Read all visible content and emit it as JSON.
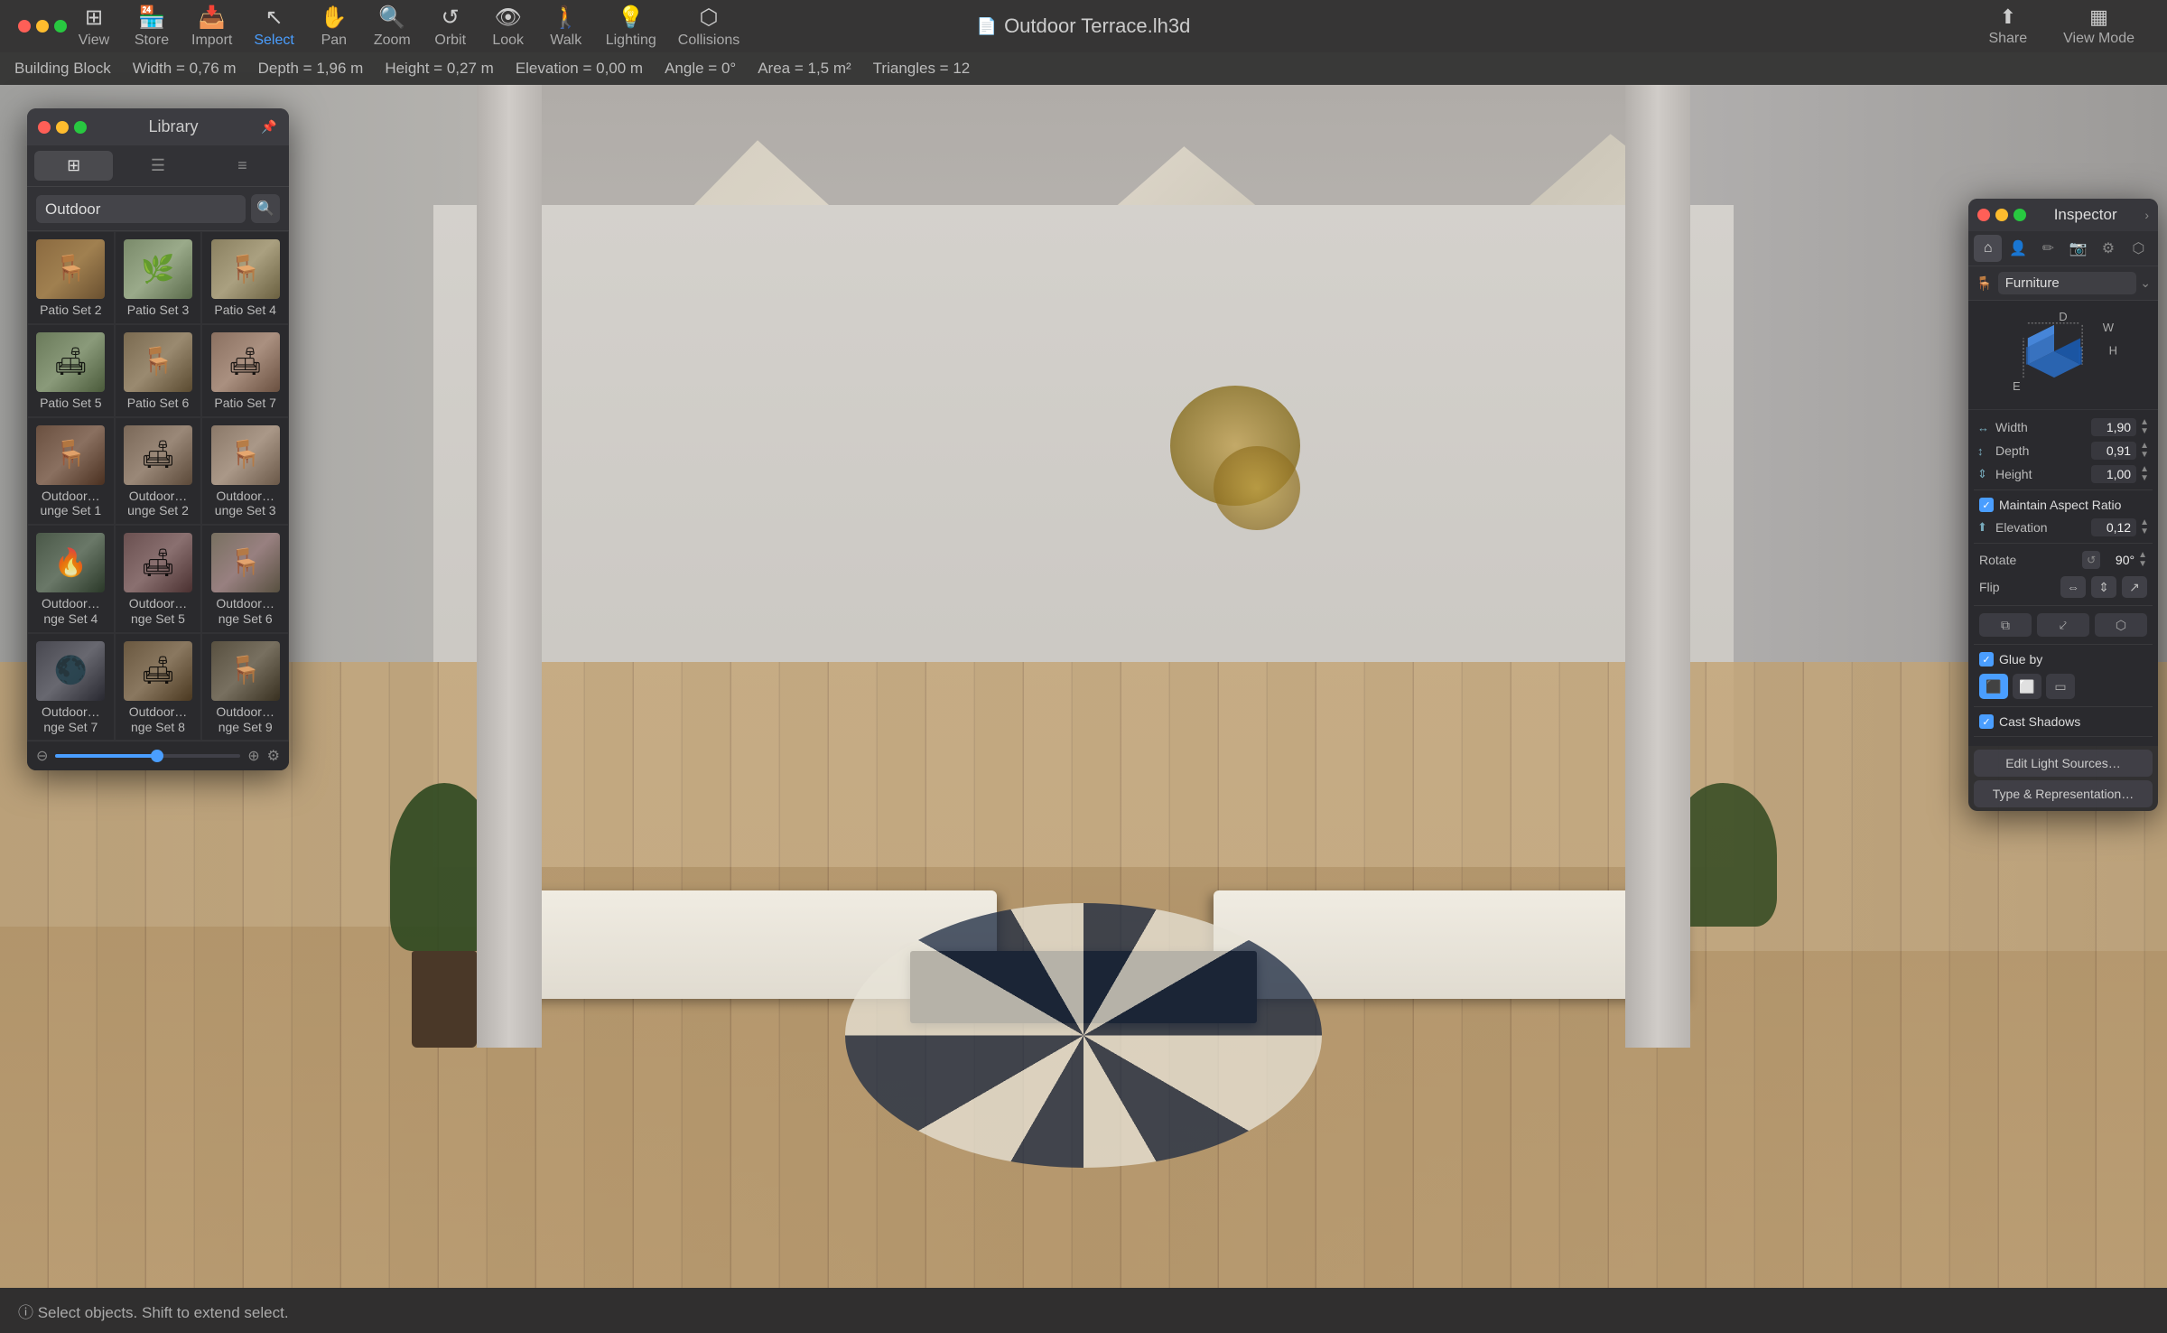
{
  "window": {
    "title": "Outdoor Terrace.lh3d",
    "traffic_lights": [
      "red",
      "yellow",
      "green"
    ]
  },
  "toolbar": {
    "items": [
      {
        "id": "view",
        "label": "View",
        "icon": "⊞"
      },
      {
        "id": "store",
        "label": "Store",
        "icon": "🛒"
      },
      {
        "id": "import",
        "label": "Import",
        "icon": "⤵"
      },
      {
        "id": "select",
        "label": "Select",
        "icon": "↖",
        "active": true
      },
      {
        "id": "pan",
        "label": "Pan",
        "icon": "✋"
      },
      {
        "id": "zoom",
        "label": "Zoom",
        "icon": "🔍"
      },
      {
        "id": "orbit",
        "label": "Orbit",
        "icon": "↺"
      },
      {
        "id": "look",
        "label": "Look",
        "icon": "👁"
      },
      {
        "id": "walk",
        "label": "Walk",
        "icon": "🚶"
      },
      {
        "id": "lighting",
        "label": "Lighting",
        "icon": "💡"
      },
      {
        "id": "collisions",
        "label": "Collisions",
        "icon": "⬡"
      }
    ]
  },
  "toolbar_right": {
    "items": [
      {
        "id": "share",
        "label": "Share",
        "icon": "⬆"
      },
      {
        "id": "view_mode",
        "label": "View Mode",
        "icon": "⬜"
      }
    ]
  },
  "info_bar": {
    "building_block": "Building Block",
    "width": "Width = 0,76 m",
    "depth": "Depth = 1,96 m",
    "height": "Height = 0,27 m",
    "elevation": "Elevation = 0,00 m",
    "angle": "Angle = 0°",
    "area": "Area = 1,5 m²",
    "triangles": "Triangles = 12"
  },
  "library": {
    "title": "Library",
    "category": "Outdoor",
    "search_placeholder": "Search",
    "items": [
      {
        "id": "patio2",
        "label": "Patio Set 2",
        "thumb": "patio2"
      },
      {
        "id": "patio3",
        "label": "Patio Set 3",
        "thumb": "patio3"
      },
      {
        "id": "patio4",
        "label": "Patio Set 4",
        "thumb": "patio4"
      },
      {
        "id": "patio5",
        "label": "Patio Set 5",
        "thumb": "patio5"
      },
      {
        "id": "patio6",
        "label": "Patio Set 6",
        "thumb": "patio6"
      },
      {
        "id": "patio7",
        "label": "Patio Set 7",
        "thumb": "patio7"
      },
      {
        "id": "lounge1",
        "label": "Outdoor…unge Set 1",
        "thumb": "lounge1"
      },
      {
        "id": "lounge2",
        "label": "Outdoor…unge Set 2",
        "thumb": "lounge2"
      },
      {
        "id": "lounge3",
        "label": "Outdoor…unge Set 3",
        "thumb": "lounge3"
      },
      {
        "id": "lounge4",
        "label": "Outdoor…nge Set 4",
        "thumb": "lounge4"
      },
      {
        "id": "lounge5",
        "label": "Outdoor…nge Set 5",
        "thumb": "lounge5"
      },
      {
        "id": "lounge6",
        "label": "Outdoor…nge Set 6",
        "thumb": "lounge6"
      },
      {
        "id": "lounge7",
        "label": "Outdoor…nge Set 7",
        "thumb": "lounge7"
      },
      {
        "id": "lounge8",
        "label": "Outdoor…nge Set 8",
        "thumb": "lounge8"
      },
      {
        "id": "lounge9",
        "label": "Outdoor…nge Set 9",
        "thumb": "lounge9"
      }
    ]
  },
  "inspector": {
    "title": "Inspector",
    "category": "Furniture",
    "tabs": [
      "home",
      "person",
      "pen",
      "camera",
      "gear",
      "cube"
    ],
    "dimensions": {
      "width_label": "Width",
      "width_value": "1,90",
      "depth_label": "Depth",
      "depth_value": "0,91",
      "height_label": "Height",
      "height_value": "1,00"
    },
    "maintain_aspect_ratio": "Maintain Aspect Ratio",
    "elevation_label": "Elevation",
    "elevation_value": "0,12",
    "rotate_label": "Rotate",
    "rotate_value": "90°",
    "flip_label": "Flip",
    "glue_by_label": "Glue by",
    "cast_shadows_label": "Cast Shadows",
    "edit_light_sources": "Edit Light Sources…",
    "type_representation": "Type & Representation…",
    "dim_labels": {
      "d": "D",
      "w": "W",
      "h": "H",
      "e": "E"
    }
  },
  "status_bar": {
    "message": "ⓘ  Select objects. Shift to extend select."
  }
}
